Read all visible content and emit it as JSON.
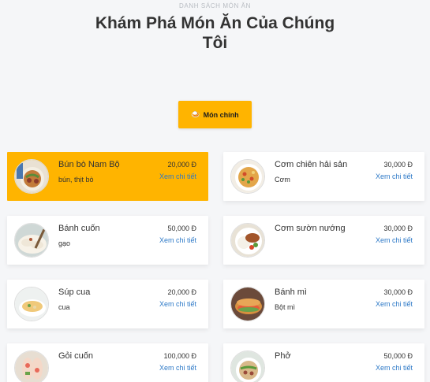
{
  "header": {
    "eyebrow": "DANH SÁCH MÓN ĂN",
    "title_line1": "Khám Phá Món Ăn Của Chúng",
    "title_line2": "Tôi"
  },
  "category": {
    "icon": "🍛",
    "label": "Món chính"
  },
  "colors": {
    "accent": "#ffb400",
    "link": "#2d79c7"
  },
  "detail_label": "Xem chi tiết",
  "dishes": [
    {
      "name": "Bún bò Nam Bộ",
      "desc": "bún, thịt bò",
      "price": "20,000 Đ",
      "icon": "bun-bo-photo",
      "active": true
    },
    {
      "name": "Cơm chiên hải sản",
      "desc": "Cơm",
      "price": "30,000 Đ",
      "icon": "fried-rice-photo"
    },
    {
      "name": "Bánh cuốn",
      "desc": "gạo",
      "price": "50,000 Đ",
      "icon": "banh-cuon-photo"
    },
    {
      "name": "Cơm sườn nướng",
      "desc": "",
      "price": "30,000 Đ",
      "icon": "com-suon-photo"
    },
    {
      "name": "Súp cua",
      "desc": "cua",
      "price": "20,000 Đ",
      "icon": "crab-soup-photo"
    },
    {
      "name": "Bánh mì",
      "desc": "Bột mì",
      "price": "30,000 Đ",
      "icon": "banh-mi-photo"
    },
    {
      "name": "Gỏi cuốn",
      "desc": "",
      "price": "100,000 Đ",
      "icon": "spring-roll-photo"
    },
    {
      "name": "Phở",
      "desc": "",
      "price": "50,000 Đ",
      "icon": "pho-photo"
    }
  ]
}
